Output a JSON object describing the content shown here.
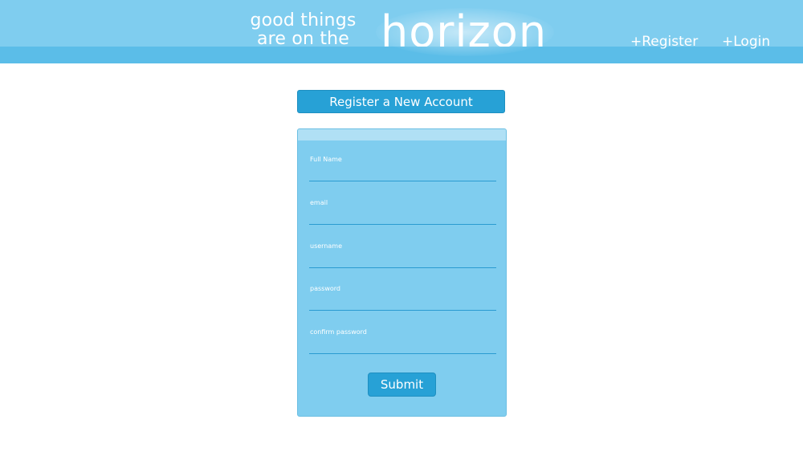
{
  "header": {
    "tagline_line1": "good things",
    "tagline_line2": "are on the",
    "logo_text": "horizon",
    "nav": {
      "register_label": "+Register",
      "login_label": "+Login"
    }
  },
  "main": {
    "title": "Register a New Account",
    "form": {
      "fields": [
        {
          "label": "Full Name",
          "value": ""
        },
        {
          "label": "email",
          "value": ""
        },
        {
          "label": "username",
          "value": ""
        },
        {
          "label": "password",
          "value": ""
        },
        {
          "label": "confirm password",
          "value": ""
        }
      ],
      "submit_label": "Submit"
    }
  },
  "colors": {
    "header_light": "#7fcdef",
    "header_band": "#5bbde8",
    "accent": "#27a1d6",
    "panel": "#7fcdef",
    "text_on_blue": "#ffffff"
  }
}
